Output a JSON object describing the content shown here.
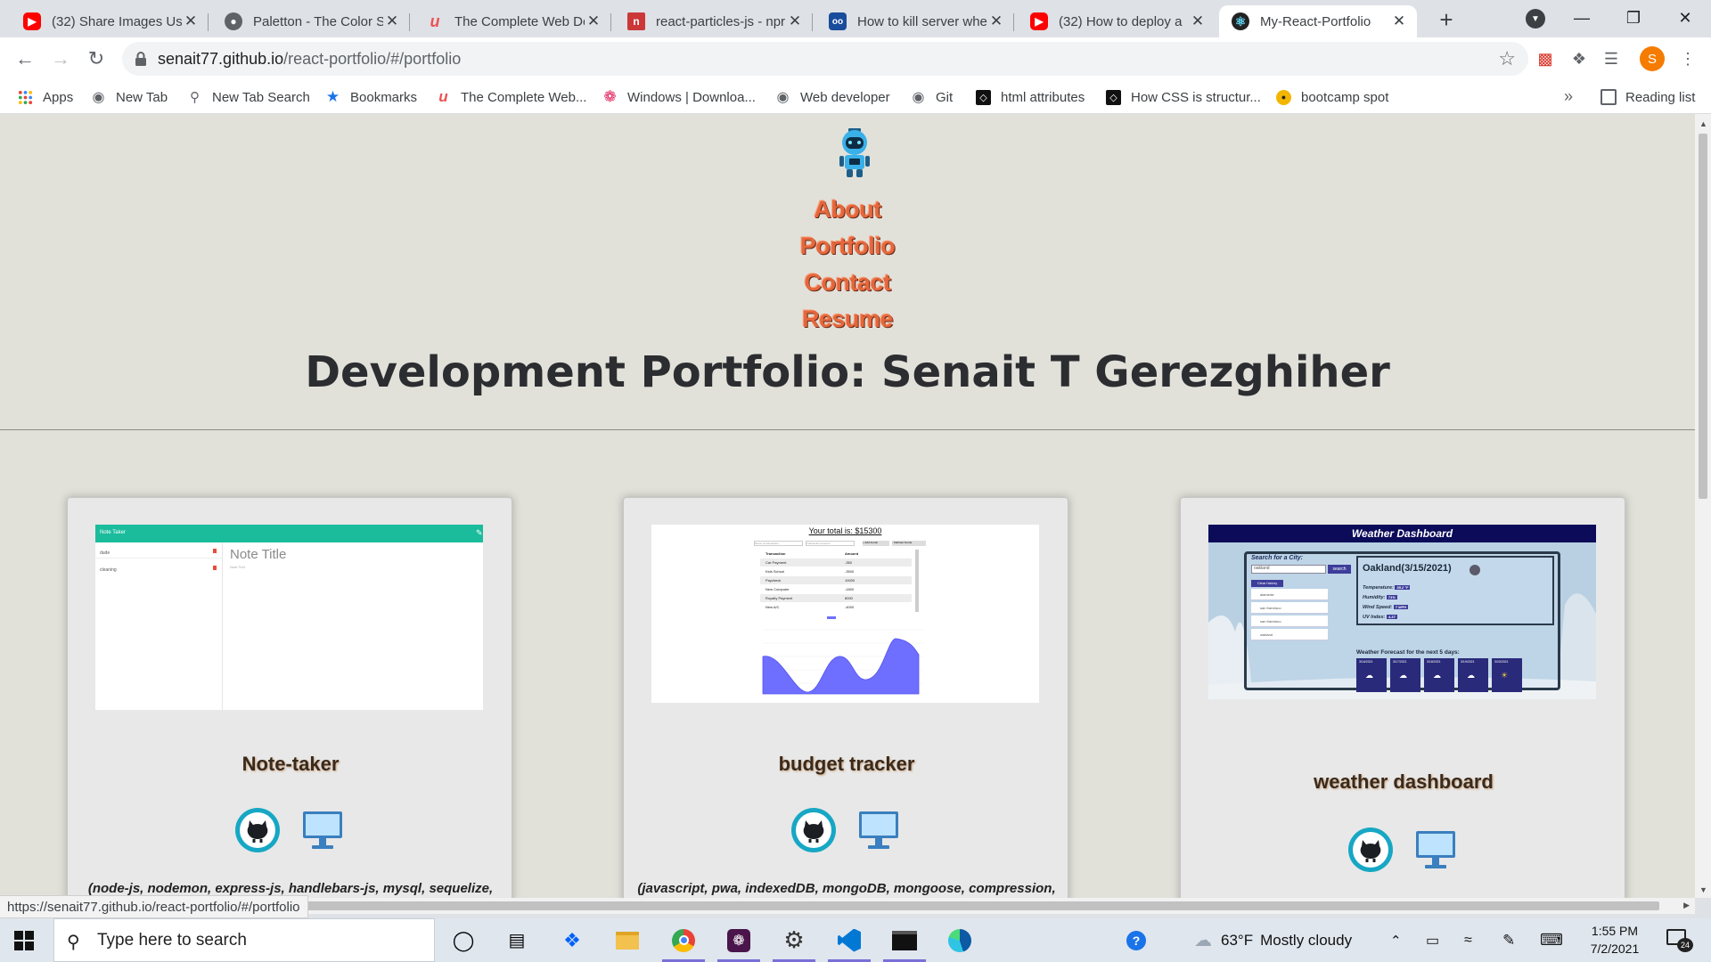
{
  "browser": {
    "tabs": [
      {
        "title": "(32) Share Images Usin",
        "favicon": "youtube-icon",
        "color": "#ff0000"
      },
      {
        "title": "Paletton - The Color S",
        "favicon": "paletton-icon",
        "color": "#5f6368"
      },
      {
        "title": "The Complete Web De",
        "favicon": "udemy-icon",
        "color": "#ec5252"
      },
      {
        "title": "react-particles-js - npr",
        "favicon": "npm-icon",
        "color": "#cb3837"
      },
      {
        "title": "How to kill server whe",
        "favicon": "codegrepper-icon",
        "color": "#1a4c9c"
      },
      {
        "title": "(32) How to deploy a",
        "favicon": "youtube-icon",
        "color": "#ff0000"
      },
      {
        "title": "My-React-Portfolio",
        "favicon": "react-icon",
        "color": "#222222"
      }
    ],
    "new_tab": "+",
    "url_host": "senait77.github.io",
    "url_path": "/react-portfolio/#/portfolio",
    "profile_initial": "S",
    "bookmarks": [
      {
        "label": "Apps",
        "icon": "apps-grid-icon"
      },
      {
        "label": "New Tab",
        "icon": "globe-icon"
      },
      {
        "label": "New Tab Search",
        "icon": "search-icon"
      },
      {
        "label": "Bookmarks",
        "icon": "star-icon"
      },
      {
        "label": "The Complete Web...",
        "icon": "udemy-icon"
      },
      {
        "label": "Windows | Downloa...",
        "icon": "slack-icon"
      },
      {
        "label": "Web developer",
        "icon": "globe-icon"
      },
      {
        "label": "Git",
        "icon": "globe-icon"
      },
      {
        "label": "html attributes",
        "icon": "codepen-icon"
      },
      {
        "label": "How CSS is structur...",
        "icon": "codepen-icon"
      },
      {
        "label": "bootcamp spot",
        "icon": "bootcampspot-icon"
      }
    ],
    "bookmarks_more": "»",
    "reading_list": "Reading list",
    "status_url": "https://senait77.github.io/react-portfolio/#/portfolio"
  },
  "site": {
    "nav": [
      "About",
      "Portfolio",
      "Contact",
      "Resume"
    ],
    "title": "Development Portfolio: Senait T Gerezghiher",
    "projects": [
      {
        "name": "Note-taker",
        "tech": "(node-js, nodemon, express-js, handlebars-js, mysql, sequelize,",
        "screenshot": {
          "header": "Note Taker",
          "list": [
            "dude",
            "cleaning"
          ],
          "note_title": "Note Title",
          "note_text": "Note Text"
        }
      },
      {
        "name": "budget tracker",
        "tech": "(javascript, pwa, indexedDB, mongoDB, mongoose, compression,",
        "screenshot": {
          "total": "Your total is: $15300",
          "inputs": [
            "Name of transaction",
            "Transaction amount"
          ],
          "buttons": [
            "+ Add Funds",
            "- Subtract Funds"
          ],
          "columns": [
            "Transaction",
            "Amount"
          ],
          "rows": [
            [
              "Car Payment",
              "-350"
            ],
            [
              "Kids School",
              "-3500"
            ],
            [
              "Paycheck",
              "10000"
            ],
            [
              "New Computer",
              "-1800"
            ],
            [
              "Royalty Payment",
              "8000"
            ],
            [
              "New A/C",
              "-4000"
            ]
          ]
        }
      },
      {
        "name": "weather dashboard",
        "tech": "",
        "screenshot": {
          "header": "Weather Dashboard",
          "search_label": "Search for a City:",
          "search_value": "oakland",
          "search_button": "search",
          "clear_button": "Clear history",
          "history": [
            "alameda",
            "san francisco",
            "san francisco",
            "oakland"
          ],
          "city": "Oakland(3/15/2021)",
          "stats": [
            "Temperature:",
            "Humidity:",
            "Wind Speed:",
            "UV Index:"
          ],
          "stat_values": [
            "55.2 °F",
            "71%",
            "7 MPH",
            "4.37"
          ],
          "forecast_title": "Weather Forecast for the next 5 days:",
          "forecast_dates": [
            "3/16/2021",
            "3/17/2021",
            "3/18/2021",
            "3/19/2021",
            "3/20/2021"
          ]
        }
      }
    ]
  },
  "taskbar": {
    "search_placeholder": "Type here to search",
    "weather_temp": "63°F",
    "weather_desc": "Mostly cloudy",
    "time": "1:55 PM",
    "date": "7/2/2021",
    "notifications": "24"
  },
  "colors": {
    "nav_link": "#e5673c",
    "page_bg": "#e1e1da",
    "github_ring": "#17a7c4"
  }
}
